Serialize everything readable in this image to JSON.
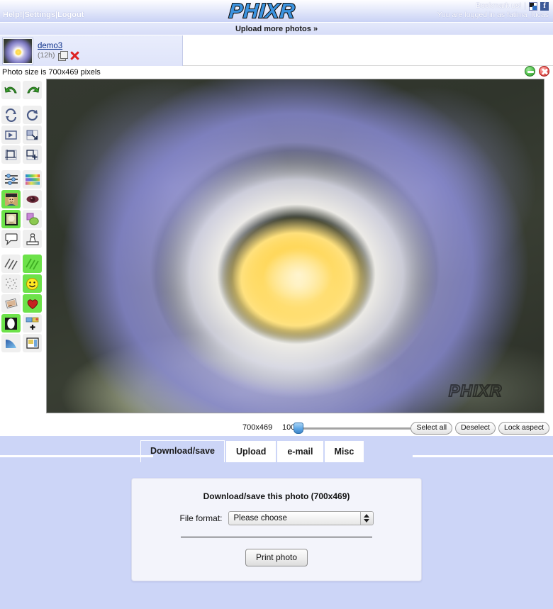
{
  "header": {
    "logo_text": "PHIXR",
    "nav": [
      {
        "label": "Help!"
      },
      {
        "label": "Settings"
      },
      {
        "label": "Logout"
      }
    ],
    "nav_separator": "|",
    "bookmark_label": "Bookmark us!",
    "bookmark_separator": "|",
    "bookmark_icon": "bookmark-icon",
    "facebook_icon": "facebook-icon",
    "facebook_glyph": "f",
    "login_status": "You are logged in as fatima_lucas"
  },
  "upload_bar": {
    "label": "Upload more photos »"
  },
  "thumbnail_strip": {
    "items": [
      {
        "name": "demo3",
        "age": "(12h)",
        "copy_icon": "duplicate-icon",
        "delete_icon": "delete-icon"
      }
    ]
  },
  "info_bar": {
    "photo_size_text": "Photo size is 700x469 pixels",
    "minimize_icon": "minimize-circle-icon",
    "close_icon": "close-circle-icon"
  },
  "toolbar": {
    "tools": [
      {
        "name": "undo-tool",
        "icon": "undo-arrow-icon",
        "active": false
      },
      {
        "name": "redo-tool",
        "icon": "redo-arrow-icon",
        "active": false
      },
      {
        "name": "rotate-free-tool",
        "icon": "rotate-two-arrows-icon",
        "active": false,
        "gap": true
      },
      {
        "name": "rotate-tool",
        "icon": "rotate-circle-icon",
        "active": false,
        "gap": true
      },
      {
        "name": "flip-tool",
        "icon": "flip-horizontal-icon",
        "active": false
      },
      {
        "name": "resize-tool",
        "icon": "resize-corner-icon",
        "active": false
      },
      {
        "name": "crop-tool",
        "icon": "crop-frame-icon",
        "active": false
      },
      {
        "name": "canvas-add-tool",
        "icon": "add-canvas-icon",
        "active": false
      },
      {
        "name": "adjust-tool",
        "icon": "sliders-icon",
        "active": false,
        "gap": true
      },
      {
        "name": "color-tool",
        "icon": "color-palette-icon",
        "active": false,
        "gap": true
      },
      {
        "name": "portrait-tool",
        "icon": "portrait-photo-icon",
        "active": true
      },
      {
        "name": "redeye-tool",
        "icon": "red-eye-icon",
        "active": false
      },
      {
        "name": "frame-photo-tool",
        "icon": "framed-photo-icon",
        "active": true
      },
      {
        "name": "shapes-tool",
        "icon": "shapes-overlap-icon",
        "active": false
      },
      {
        "name": "speech-bubble-tool",
        "icon": "speech-bubble-icon",
        "active": false
      },
      {
        "name": "stamp-tool",
        "icon": "stamp-icon",
        "active": false
      },
      {
        "name": "lines-tool",
        "icon": "diagonal-lines-icon",
        "active": false,
        "gap": true
      },
      {
        "name": "texture-tool",
        "icon": "green-stripes-icon",
        "active": true,
        "gap": true
      },
      {
        "name": "noise-tool",
        "icon": "noise-dots-icon",
        "active": false
      },
      {
        "name": "smiley-tool",
        "icon": "smiley-icon",
        "active": true
      },
      {
        "name": "tilt-photo-tool",
        "icon": "tilted-photo-icon",
        "active": false
      },
      {
        "name": "heart-tool",
        "icon": "heart-icon",
        "active": true
      },
      {
        "name": "vignette-tool",
        "icon": "oval-mask-icon",
        "active": true
      },
      {
        "name": "collage-add-tool",
        "icon": "collage-plus-icon",
        "active": false
      },
      {
        "name": "gradient-tool",
        "icon": "blue-gradient-icon",
        "active": false
      },
      {
        "name": "border-tool",
        "icon": "page-border-icon",
        "active": false
      }
    ]
  },
  "canvas": {
    "watermark_text": "PHIXR",
    "photo_alt": "water lily flower",
    "background_color": "#2e332c"
  },
  "zoom_bar": {
    "dimensions": "700x469",
    "zoom_percent": "100%",
    "slider_value": 0,
    "buttons": [
      {
        "label": "Select all",
        "name": "select-all-button"
      },
      {
        "label": "Deselect",
        "name": "deselect-button"
      },
      {
        "label": "Lock aspect",
        "name": "lock-aspect-button"
      }
    ]
  },
  "tabs": [
    {
      "label": "Download/save",
      "name": "tab-download-save",
      "active": true
    },
    {
      "label": "Upload",
      "name": "tab-upload",
      "active": false
    },
    {
      "label": "e-mail",
      "name": "tab-email",
      "active": false
    },
    {
      "label": "Misc",
      "name": "tab-misc",
      "active": false
    }
  ],
  "panel": {
    "title": "Download/save this photo (700x469)",
    "file_format_label": "File format:",
    "file_format_value": "Please choose",
    "print_button_label": "Print photo"
  },
  "colors": {
    "header_gradient_start": "#fdfdff",
    "header_gradient_end": "#c9d2f5",
    "panel_background": "#ccd5f7",
    "accent_blue": "#2f6fc4",
    "link_blue": "#0b2f8a",
    "highlight_green": "#6de24a"
  }
}
